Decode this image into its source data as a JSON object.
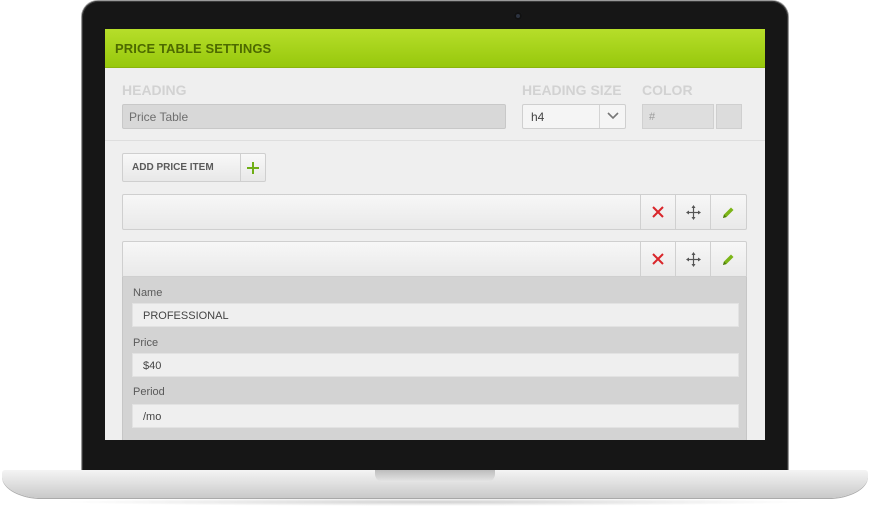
{
  "header": {
    "title": "PRICE TABLE SETTINGS"
  },
  "settings": {
    "heading_label": "HEADING",
    "heading_value": "Price Table",
    "size_label": "HEADING SIZE",
    "size_value": "h4",
    "color_label": "COLOR",
    "color_value": "#"
  },
  "add_item": {
    "label": "ADD PRICE ITEM",
    "icon": "plus-icon"
  },
  "item_actions": {
    "delete_icon": "close-icon",
    "move_icon": "move-icon",
    "edit_icon": "pencil-icon"
  },
  "edit_form": {
    "fields": [
      {
        "label": "Name",
        "value": "PROFESSIONAL"
      },
      {
        "label": "Price",
        "value": "$40"
      },
      {
        "label": "Period",
        "value": "/mo"
      }
    ]
  },
  "colors": {
    "accent": "#a3d11a",
    "delete": "#d9262b",
    "edit": "#7cb518"
  }
}
